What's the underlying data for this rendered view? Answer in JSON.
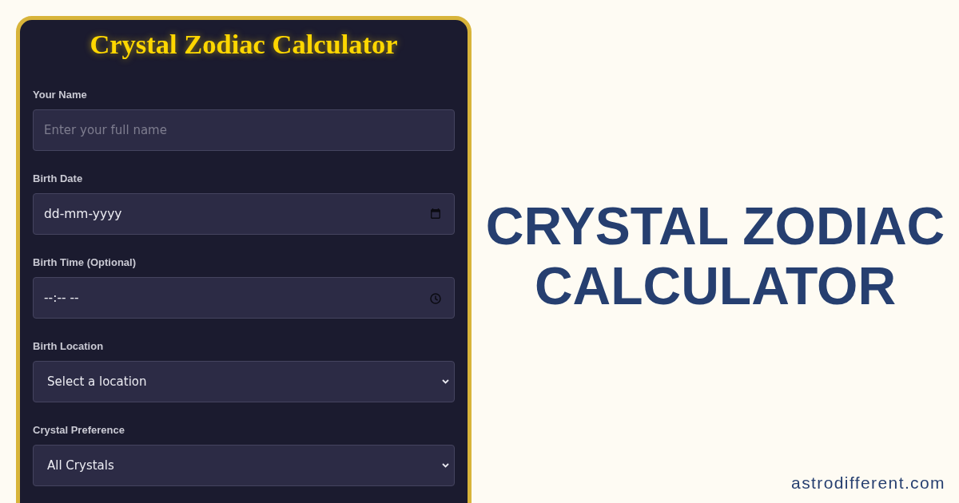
{
  "form": {
    "title": "Crystal Zodiac Calculator",
    "fields": [
      {
        "kind": "text",
        "label": "Your Name",
        "placeholder": "Enter your full name"
      },
      {
        "kind": "date",
        "label": "Birth Date",
        "placeholder": "dd-mm-yyyy"
      },
      {
        "kind": "time",
        "label": "Birth Time (Optional)",
        "placeholder": "--:-- --"
      },
      {
        "kind": "select",
        "label": "Birth Location",
        "value": "Select a location"
      },
      {
        "kind": "select",
        "label": "Crystal Preference",
        "value": "All Crystals"
      }
    ]
  },
  "headline": "CRYSTAL ZODIAC CALCULATOR",
  "website": "astrodifferent.com"
}
